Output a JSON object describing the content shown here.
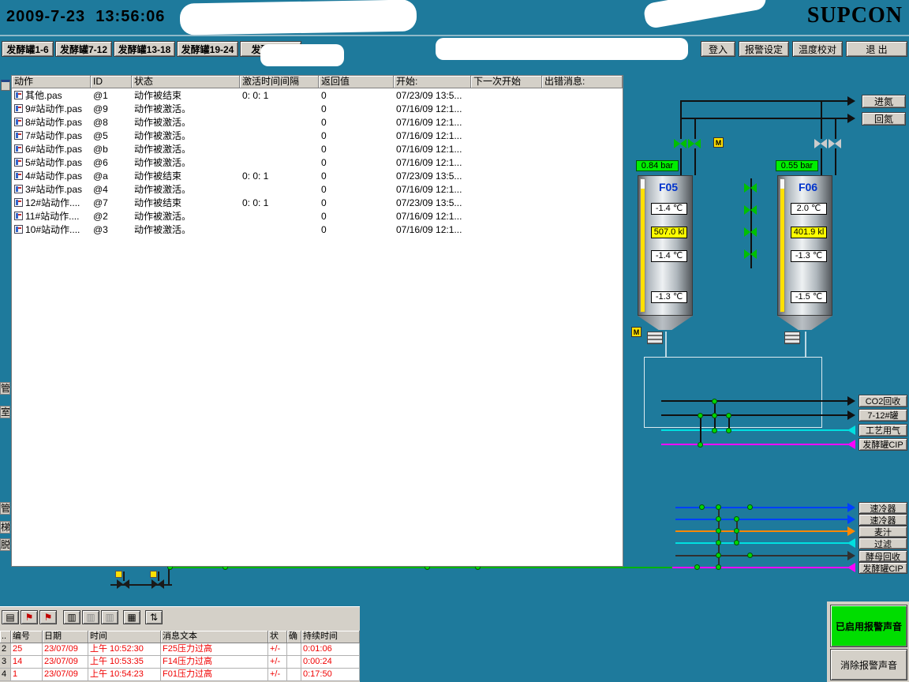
{
  "header": {
    "datetime": "2009-7-23  13:56:06",
    "brand": "SUPCON"
  },
  "nav": {
    "tabs": [
      {
        "label": "发酵罐1-6"
      },
      {
        "label": "发酵罐7-12"
      },
      {
        "label": "发酵罐13-18"
      },
      {
        "label": "发酵罐19-24"
      },
      {
        "label": "发酵罐25"
      }
    ],
    "buttons": [
      {
        "label": "登入"
      },
      {
        "label": "报警设定"
      },
      {
        "label": "温度校对"
      },
      {
        "label": "退 出"
      }
    ]
  },
  "action_list": {
    "headers": {
      "action": "动作",
      "id": "ID",
      "status": "状态",
      "interval": "激活时间间隔",
      "ret": "返回值",
      "start": "开始:",
      "next": "下一次开始",
      "error": "出错消息:"
    },
    "rows": [
      {
        "action": "其他.pas",
        "id": "@1",
        "status": "动作被结束",
        "interval": "0: 0: 1",
        "ret": "0",
        "start": "07/23/09 13:5...",
        "next": "",
        "error": ""
      },
      {
        "action": "9#站动作.pas",
        "id": "@9",
        "status": "动作被激活。",
        "interval": "",
        "ret": "0",
        "start": "07/16/09 12:1...",
        "next": "",
        "error": ""
      },
      {
        "action": "8#站动作.pas",
        "id": "@8",
        "status": "动作被激活。",
        "interval": "",
        "ret": "0",
        "start": "07/16/09 12:1...",
        "next": "",
        "error": ""
      },
      {
        "action": "7#站动作.pas",
        "id": "@5",
        "status": "动作被激活。",
        "interval": "",
        "ret": "0",
        "start": "07/16/09 12:1...",
        "next": "",
        "error": ""
      },
      {
        "action": "6#站动作.pas",
        "id": "@b",
        "status": "动作被激活。",
        "interval": "",
        "ret": "0",
        "start": "07/16/09 12:1...",
        "next": "",
        "error": ""
      },
      {
        "action": "5#站动作.pas",
        "id": "@6",
        "status": "动作被激活。",
        "interval": "",
        "ret": "0",
        "start": "07/16/09 12:1...",
        "next": "",
        "error": ""
      },
      {
        "action": "4#站动作.pas",
        "id": "@a",
        "status": "动作被结束",
        "interval": "0: 0: 1",
        "ret": "0",
        "start": "07/23/09 13:5...",
        "next": "",
        "error": ""
      },
      {
        "action": "3#站动作.pas",
        "id": "@4",
        "status": "动作被激活。",
        "interval": "",
        "ret": "0",
        "start": "07/16/09 12:1...",
        "next": "",
        "error": ""
      },
      {
        "action": "12#站动作....",
        "id": "@7",
        "status": "动作被结束",
        "interval": "0: 0: 1",
        "ret": "0",
        "start": "07/23/09 13:5...",
        "next": "",
        "error": ""
      },
      {
        "action": "11#站动作....",
        "id": "@2",
        "status": "动作被激活。",
        "interval": "",
        "ret": "0",
        "start": "07/16/09 12:1...",
        "next": "",
        "error": ""
      },
      {
        "action": "10#站动作....",
        "id": "@3",
        "status": "动作被激活。",
        "interval": "",
        "ret": "0",
        "start": "07/16/09 12:1...",
        "next": "",
        "error": ""
      }
    ]
  },
  "tanks": [
    {
      "name": "F05",
      "pressure": "0.84",
      "pressure_unit": "bar",
      "temp_top": "-1.4 ℃",
      "volume": "507.0 kl",
      "temp_mid": "-1.4 ℃",
      "temp_bottom": "-1.3 ℃"
    },
    {
      "name": "F06",
      "pressure": "0.55",
      "pressure_unit": "bar",
      "temp_top": "2.0 ℃",
      "volume": "401.9 kl",
      "temp_mid": "-1.3 ℃",
      "temp_bottom": "-1.5 ℃"
    }
  ],
  "gas_lines": [
    {
      "label": "进氮"
    },
    {
      "label": "回氮"
    }
  ],
  "mid_lines": [
    {
      "label": "CO2回收",
      "color": "#101010",
      "dir": "right"
    },
    {
      "label": "7-12#罐",
      "color": "#101010",
      "dir": "right"
    },
    {
      "label": "工艺用气",
      "color": "#00e0e0",
      "dir": "left"
    },
    {
      "label": "发酵罐CIP",
      "color": "#ff00ff",
      "dir": "left"
    }
  ],
  "bottom_lines": [
    {
      "label": "速冷器",
      "color": "#0040ff",
      "dir": "right"
    },
    {
      "label": "速冷器",
      "color": "#0040ff",
      "dir": "right"
    },
    {
      "label": "麦汁",
      "color": "#ff8800",
      "dir": "right"
    },
    {
      "label": "过滤",
      "color": "#00e0e0",
      "dir": "left"
    },
    {
      "label": "酵母回收",
      "color": "#303030",
      "dir": "right"
    },
    {
      "label": "发酵罐CIP",
      "color": "#ff00ff",
      "dir": "left"
    }
  ],
  "alarm_panel": {
    "toolbar": [
      {
        "name": "alarm-log-icon",
        "glyph": "▤",
        "color": "#000000"
      },
      {
        "name": "alarm-flag-icon",
        "glyph": "⚑",
        "color": "#c00000"
      },
      {
        "name": "alarm-flag-icon-2",
        "glyph": "⚑",
        "color": "#c00000"
      },
      {
        "name": "alarm-page-icon",
        "glyph": "▥",
        "color": "#000000"
      },
      {
        "name": "alarm-list-icon",
        "glyph": "▥",
        "color": "#8a8a8a"
      },
      {
        "name": "alarm-list-icon-2",
        "glyph": "▥",
        "color": "#8a8a8a"
      },
      {
        "name": "alarm-grid-icon",
        "glyph": "▦",
        "color": "#000000"
      },
      {
        "name": "alarm-sort-icon",
        "glyph": "⇅",
        "color": "#000000"
      }
    ],
    "headers": {
      "sel": "..",
      "num": "编号",
      "date": "日期",
      "time": "时间",
      "msg": "消息文本",
      "state": "状",
      "ack": "确",
      "duration": "持续时间"
    },
    "rows": [
      {
        "idx": "2",
        "num": "25",
        "date": "23/07/09",
        "time": "上午 10:52:30",
        "msg": "F25压力过高",
        "state": "+/-",
        "ack": "",
        "duration": "0:01:06"
      },
      {
        "idx": "3",
        "num": "14",
        "date": "23/07/09",
        "time": "上午 10:53:35",
        "msg": "F14压力过高",
        "state": "+/-",
        "ack": "",
        "duration": "0:00:24"
      },
      {
        "idx": "4",
        "num": "1",
        "date": "23/07/09",
        "time": "上午 10:54:23",
        "msg": "F01压力过高",
        "state": "+/-",
        "ack": "",
        "duration": "0:17:50"
      }
    ],
    "sound_on": "已启用报警声音",
    "mute": "消除报警声音"
  },
  "left_edge": [
    "管",
    "室",
    "管",
    "梯",
    "脱"
  ],
  "colors": {
    "background": "#1e7a9c",
    "alarm_text": "#ff0000",
    "tank_name": "#0033cc",
    "pressure_bg": "#00ee00",
    "volume_bg": "#ffff00",
    "button_bg": "#d4d0c8",
    "sound_on_bg": "#00dd00"
  }
}
